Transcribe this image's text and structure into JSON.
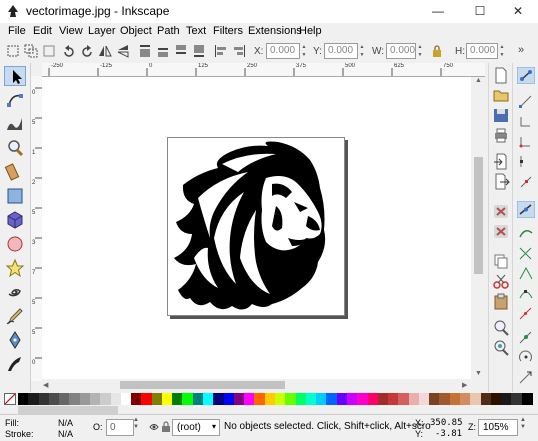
{
  "window": {
    "title": "vectorimage.jpg - Inkscape",
    "minimize": "—",
    "maximize": "☐",
    "close": "✕"
  },
  "menu": [
    "File",
    "Edit",
    "View",
    "Layer",
    "Object",
    "Path",
    "Text",
    "Filters",
    "Extensions",
    "Help"
  ],
  "toolbar": {
    "x_label": "X:",
    "x_value": "0.000",
    "y_label": "Y:",
    "y_value": "0.000",
    "w_label": "W:",
    "w_value": "0.000",
    "h_label": "H:",
    "h_value": "0.000",
    "overflow": "»"
  },
  "ruler": {
    "top_labels": [
      "-250",
      "-125",
      "0",
      "125",
      "250",
      "375",
      "500",
      "625",
      "750"
    ],
    "left_labels": [
      "0",
      "5",
      "1",
      "2",
      "5",
      "3",
      "7",
      "5",
      "5",
      "0"
    ]
  },
  "tools": [
    {
      "name": "selector-tool",
      "icon": "arrow-cursor"
    },
    {
      "name": "node-tool",
      "icon": "node-edit"
    },
    {
      "name": "tweak-tool",
      "icon": "tweak-wave"
    },
    {
      "name": "zoom-tool",
      "icon": "magnifier"
    },
    {
      "name": "measure-tool",
      "icon": "ruler"
    },
    {
      "name": "rectangle-tool",
      "icon": "rectangle"
    },
    {
      "name": "3dbox-tool",
      "icon": "cube"
    },
    {
      "name": "ellipse-tool",
      "icon": "circle"
    },
    {
      "name": "star-tool",
      "icon": "star"
    },
    {
      "name": "spiral-tool",
      "icon": "spiral"
    },
    {
      "name": "pencil-tool",
      "icon": "pencil"
    },
    {
      "name": "pen-tool",
      "icon": "pen"
    },
    {
      "name": "calligraphy-tool",
      "icon": "calligraphy"
    }
  ],
  "colors": {
    "accent": "#c6daf0",
    "palette": [
      "#000000",
      "#1a1a1a",
      "#333333",
      "#4d4d4d",
      "#666666",
      "#808080",
      "#999999",
      "#b3b3b3",
      "#cccccc",
      "#e6e6e6",
      "#ffffff",
      "#800000",
      "#ff0000",
      "#808000",
      "#ffff00",
      "#008000",
      "#00ff00",
      "#008080",
      "#00ffff",
      "#000080",
      "#0000ff",
      "#800080",
      "#ff00ff",
      "#ff6600",
      "#ffcc00",
      "#ccff00",
      "#66ff00",
      "#00ff66",
      "#00ffcc",
      "#00ccff",
      "#0066ff",
      "#6600ff",
      "#cc00ff",
      "#ff00cc",
      "#ff0066",
      "#a02c2c",
      "#c83737",
      "#d35f5f",
      "#e9afaf",
      "#f4d7d7",
      "#784421",
      "#a05a2c",
      "#c87137",
      "#d38d5f",
      "#e9c6af",
      "#502d16",
      "#2b1100",
      "#1a1a1a",
      "#333333",
      "#000000"
    ]
  },
  "status": {
    "fill_label": "Fill:",
    "fill_value": "N/A",
    "stroke_label": "Stroke:",
    "stroke_value": "N/A",
    "opacity_label": "O:",
    "opacity_value": "0",
    "layer_value": "(root)",
    "message": "No objects selected. Click, Shift+click, Alt+scro",
    "cursor_x_label": "X:",
    "cursor_x": "350.85",
    "cursor_y_label": "Y:",
    "cursor_y": "-3.81",
    "zoom_label": "Z:",
    "zoom_value": "105%"
  }
}
